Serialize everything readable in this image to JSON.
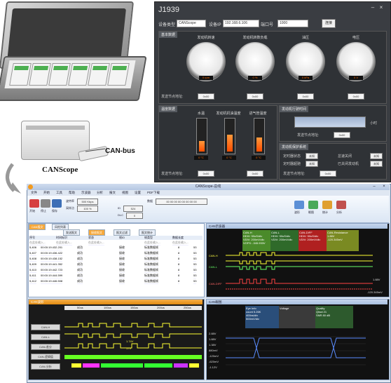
{
  "labels": {
    "can_bus": "CAN-bus",
    "canscope": "CANScope"
  },
  "j1939": {
    "title": "J1939",
    "toolbar": {
      "device_type_label": "设备类型",
      "device_type_value": "CANScope",
      "device_ip_label": "设备IP",
      "device_ip_value": "192.168.6.106",
      "port_label": "端口号",
      "port_value": "1000",
      "connect_label": "连接"
    },
    "basic_section": "基本数据",
    "gauges": [
      {
        "label": "发动机转速",
        "readout": "0 rpm"
      },
      {
        "label": "发动机转数负载",
        "readout": "0 %"
      },
      {
        "label": "油压",
        "readout": "0 kPa"
      },
      {
        "label": "电压",
        "readout": "0 V"
      }
    ],
    "send_addr_label": "发送节点地址:",
    "send_addr_values": [
      "0x00",
      "0x00",
      "0x00",
      "0x00"
    ],
    "temp_section": "温度数据",
    "thermometers": [
      {
        "label": "水温",
        "readout": "0 °C",
        "level": 0.35
      },
      {
        "label": "发动机机油温度",
        "readout": "0 °C",
        "level": 0.55
      },
      {
        "label": "进气管温度",
        "readout": "0 °C",
        "level": 0.45
      }
    ],
    "temp_send_values": [
      "0x00",
      "0x00"
    ],
    "time_section": "发动机行驶时间",
    "time_unit": "小时",
    "time_send_value": "0x00",
    "system_section": "发动机保护系统",
    "system_items": [
      {
        "label": "定时器状态",
        "value": "未知"
      },
      {
        "label": "怠速关闭",
        "value": "未知"
      },
      {
        "label": "定时器超驰",
        "value": "未知"
      },
      {
        "label": "已关闭发动机",
        "value": "未知"
      }
    ],
    "system_send_value": "0x00"
  },
  "canscope": {
    "window_title": "CANScope-总线",
    "menu": [
      "文件",
      "开始",
      "工具",
      "帮助",
      "示波器",
      "分析",
      "报文",
      "视图",
      "设置",
      "PDF下载"
    ],
    "ribbon": {
      "buttons": [
        "开始",
        "停止",
        "保存"
      ],
      "fields": [
        {
          "label": "波特率",
          "value": "500 Kbps"
        },
        {
          "label": "采样点",
          "value": "100 %"
        },
        {
          "label": "ID",
          "value": "524"
        },
        {
          "label": "DLC",
          "value": "0"
        },
        {
          "label": "数据",
          "value": "00 00 00 00 00 00 00 00"
        }
      ],
      "right_buttons": [
        "波形",
        "眼图",
        "统计",
        "分析"
      ]
    },
    "msg_pane": {
      "tabs": [
        "CAN报文",
        "风险列表"
      ],
      "subtabs": [
        "发送报文",
        "接收报文",
        "报文过滤",
        "报文统计"
      ],
      "columns": [
        "序号",
        "时间标识",
        "状态",
        "帧ID",
        "帧类型",
        "数据长度"
      ],
      "filter_hint": "在此处输入...",
      "rows": [
        {
          "seq": "5,406",
          "time": "00:00:19.432.201",
          "status": "成功",
          "dir": "接收",
          "type": "标准数据帧",
          "len": "8",
          "id": "53"
        },
        {
          "seq": "5,407",
          "time": "00:00:19.436.422",
          "status": "成功",
          "dir": "接收",
          "type": "标准数据帧",
          "len": "8",
          "id": "53"
        },
        {
          "seq": "5,408",
          "time": "00:00:19.438.152",
          "status": "成功",
          "dir": "接收",
          "type": "标准数据帧",
          "len": "8",
          "id": "53"
        },
        {
          "seq": "5,409",
          "time": "00:00:19.441.352",
          "status": "成功",
          "dir": "接收",
          "type": "标准数据帧",
          "len": "8",
          "id": "53"
        },
        {
          "seq": "5,410",
          "time": "00:00:19.442.723",
          "status": "成功",
          "dir": "接收",
          "type": "标准数据帧",
          "len": "8",
          "id": "53"
        },
        {
          "seq": "5,411",
          "time": "00:00:19.444.599",
          "status": "成功",
          "dir": "接收",
          "type": "标准数据帧",
          "len": "8",
          "id": "53"
        },
        {
          "seq": "5,412",
          "time": "00:00:19.446.508",
          "status": "成功",
          "dir": "接收",
          "type": "标准数据帧",
          "len": "8",
          "id": "53"
        }
      ]
    },
    "wave_pane": {
      "title": "CAN示波器",
      "channels": [
        "CAN-H",
        "CAN-L",
        "CAN-DIFF",
        "CAN-Resistance"
      ],
      "info": [
        "HDIV: 50uS/div",
        "VDIV: 200mV/div",
        "VOFS: -345.933V"
      ],
      "right_values": [
        "1.88V",
        "-120.345mV"
      ],
      "trace_labels": [
        "CAN-H",
        "CAN-L",
        "CAN-DIFF"
      ]
    },
    "analysis_pane": {
      "title": "CAN波形",
      "rows": [
        "CAN-H",
        "CAN-L",
        "CAN-差分",
        "CAN-逻辑值",
        "CAN-分析"
      ],
      "marks": [
        "1.74V",
        "17V"
      ],
      "scale": [
        "50us",
        "100us",
        "150us",
        "200us",
        "250us"
      ]
    },
    "eye_pane": {
      "title": "CAN眼图",
      "eye_info_title": "Eye Info",
      "eye_info": [
        "count  5.26K",
        "400ns/div",
        "500mV/div"
      ],
      "voltage_title": "Voltage",
      "quality_title": "Quality",
      "quality": [
        "Qfact  21",
        "SNR  80 dB"
      ],
      "y_ticks": [
        "2.88V",
        "1.88V",
        "1.38V",
        "880mV",
        "-120mV",
        "-620mV",
        "-1.12V"
      ]
    }
  }
}
